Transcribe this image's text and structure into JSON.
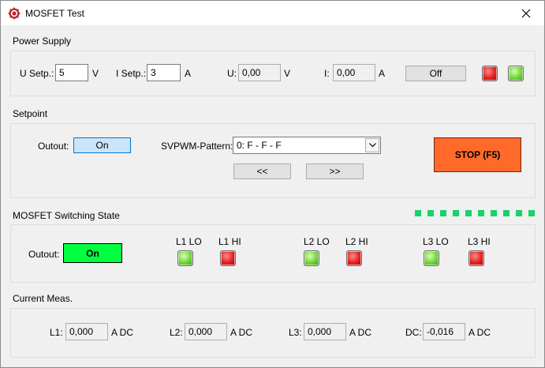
{
  "window": {
    "title": "MOSFET Test"
  },
  "power_supply": {
    "heading": "Power Supply",
    "u_setp_label": "U Setp.:",
    "u_setp_value": "5",
    "u_setp_unit": "V",
    "i_setp_label": "I Setp.:",
    "i_setp_value": "3",
    "i_setp_unit": "A",
    "u_label": "U:",
    "u_value": "0,00",
    "u_unit": "V",
    "i_label": "I:",
    "i_value": "0,00",
    "i_unit": "A",
    "toggle_label": "Off"
  },
  "setpoint": {
    "heading": "Setpoint",
    "output_label": "Outout:",
    "output_button": "On",
    "pattern_label": "SVPWM-Pattern:",
    "pattern_value": "0: F - F - F",
    "prev_label": "<<",
    "next_label": ">>",
    "stop_label": "STOP (F5)"
  },
  "switching": {
    "heading": "MOSFET Switching State",
    "output_label": "Outout:",
    "output_state": "On",
    "channels": [
      "L1 LO",
      "L1 HI",
      "L2 LO",
      "L2 HI",
      "L3 LO",
      "L3 HI"
    ]
  },
  "current": {
    "heading": "Current Meas.",
    "l1_label": "L1:",
    "l1_value": "0,000",
    "l1_unit": "A DC",
    "l2_label": "L2:",
    "l2_value": "0,000",
    "l2_unit": "A DC",
    "l3_label": "L3:",
    "l3_value": "0,000",
    "l3_unit": "A DC",
    "dc_label": "DC:",
    "dc_value": "-0,016",
    "dc_unit": "A DC"
  },
  "colors": {
    "green_active": "#00ff40",
    "stop_orange": "#ff6a2b",
    "on_blue": "#cce4f7",
    "indicator_green": "#19d26b"
  }
}
